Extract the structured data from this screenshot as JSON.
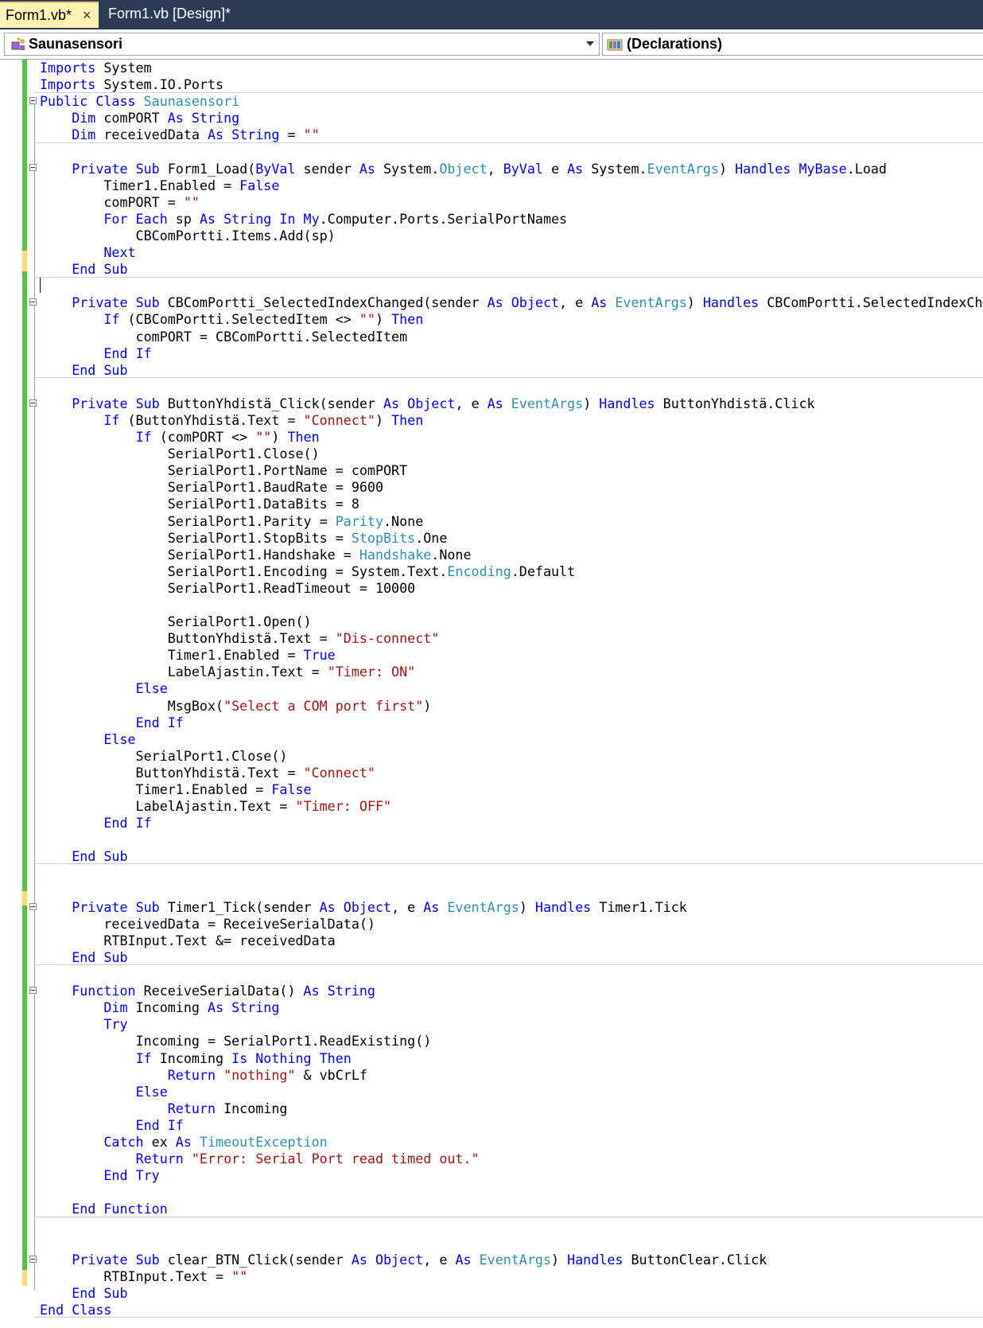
{
  "tabs": [
    {
      "label": "Form1.vb*",
      "close_icon": "×",
      "active": true
    },
    {
      "label": "Form1.vb [Design]*",
      "active": false
    }
  ],
  "nav": {
    "class_combo": "Saunasensori",
    "member_combo": "(Declarations)"
  },
  "colors": {
    "keyword": "#0000ff",
    "type": "#2b91af",
    "string": "#a31515",
    "changed_saved": "#55c340",
    "changed_unsaved": "#f7dc6f",
    "tab_bar": "#2b3a55",
    "active_tab": "#fff0b3"
  },
  "code_lines": [
    [
      [
        "Imports",
        "kw"
      ],
      [
        " System"
      ]
    ],
    [
      [
        "Imports",
        "kw"
      ],
      [
        " System.IO.Ports"
      ]
    ],
    [
      [
        "Public",
        "kw"
      ],
      [
        " "
      ],
      [
        "Class",
        "kw"
      ],
      [
        " "
      ],
      [
        "Saunasensori",
        "ty"
      ]
    ],
    [
      [
        "    "
      ],
      [
        "Dim",
        "kw"
      ],
      [
        " comPORT "
      ],
      [
        "As",
        "kw"
      ],
      [
        " "
      ],
      [
        "String",
        "kw"
      ]
    ],
    [
      [
        "    "
      ],
      [
        "Dim",
        "kw"
      ],
      [
        " receivedData "
      ],
      [
        "As",
        "kw"
      ],
      [
        " "
      ],
      [
        "String",
        "kw"
      ],
      [
        " = "
      ],
      [
        "\"\"",
        "st"
      ]
    ],
    [
      [
        ""
      ]
    ],
    [
      [
        "    "
      ],
      [
        "Private",
        "kw"
      ],
      [
        " "
      ],
      [
        "Sub",
        "kw"
      ],
      [
        " Form1_Load("
      ],
      [
        "ByVal",
        "kw"
      ],
      [
        " sender "
      ],
      [
        "As",
        "kw"
      ],
      [
        " System."
      ],
      [
        "Object",
        "ty"
      ],
      [
        ", "
      ],
      [
        "ByVal",
        "kw"
      ],
      [
        " e "
      ],
      [
        "As",
        "kw"
      ],
      [
        " System."
      ],
      [
        "EventArgs",
        "ty"
      ],
      [
        ") "
      ],
      [
        "Handles",
        "kw"
      ],
      [
        " "
      ],
      [
        "MyBase",
        "kw"
      ],
      [
        ".Load"
      ]
    ],
    [
      [
        "        Timer1.Enabled = "
      ],
      [
        "False",
        "kw"
      ]
    ],
    [
      [
        "        comPORT = "
      ],
      [
        "\"\"",
        "st"
      ]
    ],
    [
      [
        "        "
      ],
      [
        "For",
        "kw"
      ],
      [
        " "
      ],
      [
        "Each",
        "kw"
      ],
      [
        " sp "
      ],
      [
        "As",
        "kw"
      ],
      [
        " "
      ],
      [
        "String",
        "kw"
      ],
      [
        " "
      ],
      [
        "In",
        "kw"
      ],
      [
        " "
      ],
      [
        "My",
        "kw"
      ],
      [
        ".Computer.Ports.SerialPortNames"
      ]
    ],
    [
      [
        "            CBComPortti.Items.Add(sp)"
      ]
    ],
    [
      [
        "        "
      ],
      [
        "Next",
        "kw"
      ]
    ],
    [
      [
        "    "
      ],
      [
        "End",
        "kw"
      ],
      [
        " "
      ],
      [
        "Sub",
        "kw"
      ]
    ],
    [
      [
        ""
      ]
    ],
    [
      [
        "    "
      ],
      [
        "Private",
        "kw"
      ],
      [
        " "
      ],
      [
        "Sub",
        "kw"
      ],
      [
        " CBComPortti_SelectedIndexChanged(sender "
      ],
      [
        "As",
        "kw"
      ],
      [
        " "
      ],
      [
        "Object",
        "kw"
      ],
      [
        ", e "
      ],
      [
        "As",
        "kw"
      ],
      [
        " "
      ],
      [
        "EventArgs",
        "ty"
      ],
      [
        ") "
      ],
      [
        "Handles",
        "kw"
      ],
      [
        " CBComPortti.SelectedIndexChanged"
      ]
    ],
    [
      [
        "        "
      ],
      [
        "If",
        "kw"
      ],
      [
        " (CBComPortti.SelectedItem <> "
      ],
      [
        "\"\"",
        "st"
      ],
      [
        ") "
      ],
      [
        "Then",
        "kw"
      ]
    ],
    [
      [
        "            comPORT = CBComPortti.SelectedItem"
      ]
    ],
    [
      [
        "        "
      ],
      [
        "End",
        "kw"
      ],
      [
        " "
      ],
      [
        "If",
        "kw"
      ]
    ],
    [
      [
        "    "
      ],
      [
        "End",
        "kw"
      ],
      [
        " "
      ],
      [
        "Sub",
        "kw"
      ]
    ],
    [
      [
        ""
      ]
    ],
    [
      [
        "    "
      ],
      [
        "Private",
        "kw"
      ],
      [
        " "
      ],
      [
        "Sub",
        "kw"
      ],
      [
        " ButtonYhdistä_Click(sender "
      ],
      [
        "As",
        "kw"
      ],
      [
        " "
      ],
      [
        "Object",
        "kw"
      ],
      [
        ", e "
      ],
      [
        "As",
        "kw"
      ],
      [
        " "
      ],
      [
        "EventArgs",
        "ty"
      ],
      [
        ") "
      ],
      [
        "Handles",
        "kw"
      ],
      [
        " ButtonYhdistä.Click"
      ]
    ],
    [
      [
        "        "
      ],
      [
        "If",
        "kw"
      ],
      [
        " (ButtonYhdistä.Text = "
      ],
      [
        "\"Connect\"",
        "st"
      ],
      [
        ") "
      ],
      [
        "Then",
        "kw"
      ]
    ],
    [
      [
        "            "
      ],
      [
        "If",
        "kw"
      ],
      [
        " (comPORT <> "
      ],
      [
        "\"\"",
        "st"
      ],
      [
        ") "
      ],
      [
        "Then",
        "kw"
      ]
    ],
    [
      [
        "                SerialPort1.Close()"
      ]
    ],
    [
      [
        "                SerialPort1.PortName = comPORT"
      ]
    ],
    [
      [
        "                SerialPort1.BaudRate = 9600"
      ]
    ],
    [
      [
        "                SerialPort1.DataBits = 8"
      ]
    ],
    [
      [
        "                SerialPort1.Parity = "
      ],
      [
        "Parity",
        "ty"
      ],
      [
        ".None"
      ]
    ],
    [
      [
        "                SerialPort1.StopBits = "
      ],
      [
        "StopBits",
        "ty"
      ],
      [
        ".One"
      ]
    ],
    [
      [
        "                SerialPort1.Handshake = "
      ],
      [
        "Handshake",
        "ty"
      ],
      [
        ".None"
      ]
    ],
    [
      [
        "                SerialPort1.Encoding = System.Text."
      ],
      [
        "Encoding",
        "ty"
      ],
      [
        ".Default"
      ]
    ],
    [
      [
        "                SerialPort1.ReadTimeout = 10000"
      ]
    ],
    [
      [
        ""
      ]
    ],
    [
      [
        "                SerialPort1.Open()"
      ]
    ],
    [
      [
        "                ButtonYhdistä.Text = "
      ],
      [
        "\"Dis-connect\"",
        "st"
      ]
    ],
    [
      [
        "                Timer1.Enabled = "
      ],
      [
        "True",
        "kw"
      ]
    ],
    [
      [
        "                LabelAjastin.Text = "
      ],
      [
        "\"Timer: ON\"",
        "st"
      ]
    ],
    [
      [
        "            "
      ],
      [
        "Else",
        "kw"
      ]
    ],
    [
      [
        "                MsgBox("
      ],
      [
        "\"Select a COM port first\"",
        "st"
      ],
      [
        ")"
      ]
    ],
    [
      [
        "            "
      ],
      [
        "End",
        "kw"
      ],
      [
        " "
      ],
      [
        "If",
        "kw"
      ]
    ],
    [
      [
        "        "
      ],
      [
        "Else",
        "kw"
      ]
    ],
    [
      [
        "            SerialPort1.Close()"
      ]
    ],
    [
      [
        "            ButtonYhdistä.Text = "
      ],
      [
        "\"Connect\"",
        "st"
      ]
    ],
    [
      [
        "            Timer1.Enabled = "
      ],
      [
        "False",
        "kw"
      ]
    ],
    [
      [
        "            LabelAjastin.Text = "
      ],
      [
        "\"Timer: OFF\"",
        "st"
      ]
    ],
    [
      [
        "        "
      ],
      [
        "End",
        "kw"
      ],
      [
        " "
      ],
      [
        "If",
        "kw"
      ]
    ],
    [
      [
        ""
      ]
    ],
    [
      [
        "    "
      ],
      [
        "End",
        "kw"
      ],
      [
        " "
      ],
      [
        "Sub",
        "kw"
      ]
    ],
    [
      [
        ""
      ]
    ],
    [
      [
        ""
      ]
    ],
    [
      [
        "    "
      ],
      [
        "Private",
        "kw"
      ],
      [
        " "
      ],
      [
        "Sub",
        "kw"
      ],
      [
        " Timer1_Tick(sender "
      ],
      [
        "As",
        "kw"
      ],
      [
        " "
      ],
      [
        "Object",
        "kw"
      ],
      [
        ", e "
      ],
      [
        "As",
        "kw"
      ],
      [
        " "
      ],
      [
        "EventArgs",
        "ty"
      ],
      [
        ") "
      ],
      [
        "Handles",
        "kw"
      ],
      [
        " Timer1.Tick"
      ]
    ],
    [
      [
        "        receivedData = ReceiveSerialData()"
      ]
    ],
    [
      [
        "        RTBInput.Text &= receivedData"
      ]
    ],
    [
      [
        "    "
      ],
      [
        "End",
        "kw"
      ],
      [
        " "
      ],
      [
        "Sub",
        "kw"
      ]
    ],
    [
      [
        ""
      ]
    ],
    [
      [
        "    "
      ],
      [
        "Function",
        "kw"
      ],
      [
        " ReceiveSerialData() "
      ],
      [
        "As",
        "kw"
      ],
      [
        " "
      ],
      [
        "String",
        "kw"
      ]
    ],
    [
      [
        "        "
      ],
      [
        "Dim",
        "kw"
      ],
      [
        " Incoming "
      ],
      [
        "As",
        "kw"
      ],
      [
        " "
      ],
      [
        "String",
        "kw"
      ]
    ],
    [
      [
        "        "
      ],
      [
        "Try",
        "kw"
      ]
    ],
    [
      [
        "            Incoming = SerialPort1.ReadExisting()"
      ]
    ],
    [
      [
        "            "
      ],
      [
        "If",
        "kw"
      ],
      [
        " Incoming "
      ],
      [
        "Is",
        "kw"
      ],
      [
        " "
      ],
      [
        "Nothing",
        "kw"
      ],
      [
        " "
      ],
      [
        "Then",
        "kw"
      ]
    ],
    [
      [
        "                "
      ],
      [
        "Return",
        "kw"
      ],
      [
        " "
      ],
      [
        "\"nothing\"",
        "st"
      ],
      [
        " & vbCrLf"
      ]
    ],
    [
      [
        "            "
      ],
      [
        "Else",
        "kw"
      ]
    ],
    [
      [
        "                "
      ],
      [
        "Return",
        "kw"
      ],
      [
        " Incoming"
      ]
    ],
    [
      [
        "            "
      ],
      [
        "End",
        "kw"
      ],
      [
        " "
      ],
      [
        "If",
        "kw"
      ]
    ],
    [
      [
        "        "
      ],
      [
        "Catch",
        "kw"
      ],
      [
        " ex "
      ],
      [
        "As",
        "kw"
      ],
      [
        " "
      ],
      [
        "TimeoutException",
        "ty"
      ]
    ],
    [
      [
        "            "
      ],
      [
        "Return",
        "kw"
      ],
      [
        " "
      ],
      [
        "\"Error: Serial Port read timed out.\"",
        "st"
      ]
    ],
    [
      [
        "        "
      ],
      [
        "End",
        "kw"
      ],
      [
        " "
      ],
      [
        "Try",
        "kw"
      ]
    ],
    [
      [
        ""
      ]
    ],
    [
      [
        "    "
      ],
      [
        "End",
        "kw"
      ],
      [
        " "
      ],
      [
        "Function",
        "kw"
      ]
    ],
    [
      [
        ""
      ]
    ],
    [
      [
        ""
      ]
    ],
    [
      [
        "    "
      ],
      [
        "Private",
        "kw"
      ],
      [
        " "
      ],
      [
        "Sub",
        "kw"
      ],
      [
        " clear_BTN_Click(sender "
      ],
      [
        "As",
        "kw"
      ],
      [
        " "
      ],
      [
        "Object",
        "kw"
      ],
      [
        ", e "
      ],
      [
        "As",
        "kw"
      ],
      [
        " "
      ],
      [
        "EventArgs",
        "ty"
      ],
      [
        ") "
      ],
      [
        "Handles",
        "kw"
      ],
      [
        " ButtonClear.Click"
      ]
    ],
    [
      [
        "        RTBInput.Text = "
      ],
      [
        "\"\"",
        "st"
      ]
    ],
    [
      [
        "    "
      ],
      [
        "End",
        "kw"
      ],
      [
        " "
      ],
      [
        "Sub",
        "kw"
      ]
    ],
    [
      [
        "End",
        "kw"
      ],
      [
        " "
      ],
      [
        "Class",
        "kw"
      ]
    ]
  ]
}
